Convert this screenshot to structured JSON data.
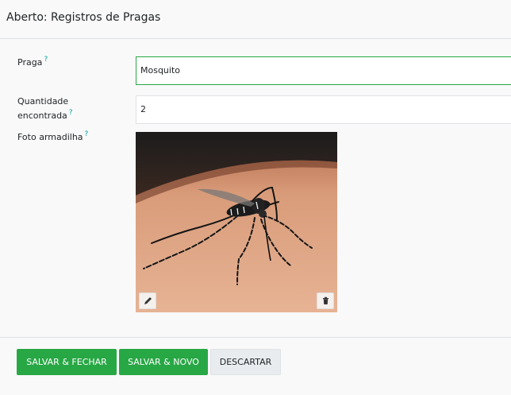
{
  "dialog": {
    "title": "Aberto: Registros de Pragas"
  },
  "form": {
    "praga": {
      "label": "Praga",
      "help": "?",
      "value": "Mosquito"
    },
    "quantidade": {
      "label_line1": "Quantidade",
      "label_line2": "encontrada",
      "help": "?",
      "value": "2"
    },
    "foto": {
      "label": "Foto armadilha",
      "help": "?"
    }
  },
  "image_actions": {
    "edit_icon": "pencil-icon",
    "delete_icon": "trash-icon"
  },
  "footer": {
    "save_close": "SALVAR & FECHAR",
    "save_new": "SALVAR & NOVO",
    "discard": "DESCARTAR"
  },
  "colors": {
    "primary": "#28a745",
    "help": "#00a09d",
    "border": "#dee2e6"
  }
}
